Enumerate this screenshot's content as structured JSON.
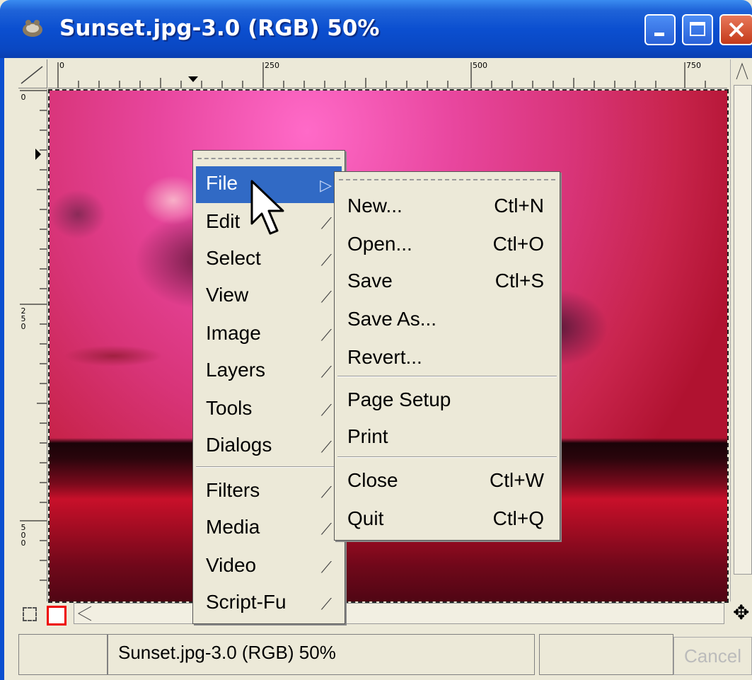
{
  "window": {
    "title": "Sunset.jpg-3.0 (RGB) 50%",
    "buttons": [
      "minimize",
      "maximize",
      "close"
    ]
  },
  "rulers": {
    "horizontal_labels": [
      "0",
      "250",
      "500",
      "750"
    ],
    "vertical_labels": [
      "0",
      "250",
      "500"
    ]
  },
  "status": {
    "text": "Sunset.jpg-3.0 (RGB) 50%",
    "cancel_label": "Cancel"
  },
  "main_menu": {
    "items": [
      {
        "label": "File",
        "selected": true
      },
      {
        "label": "Edit"
      },
      {
        "label": "Select"
      },
      {
        "label": "View"
      },
      {
        "label": "Image"
      },
      {
        "label": "Layers"
      },
      {
        "label": "Tools"
      },
      {
        "label": "Dialogs"
      },
      {
        "label": "Filters"
      },
      {
        "label": "Media"
      },
      {
        "label": "Video"
      },
      {
        "label": "Script-Fu"
      }
    ]
  },
  "file_menu": {
    "items": [
      {
        "label": "New...",
        "shortcut": "Ctl+N"
      },
      {
        "label": "Open...",
        "shortcut": "Ctl+O"
      },
      {
        "label": "Save",
        "shortcut": "Ctl+S"
      },
      {
        "label": "Save As...",
        "shortcut": ""
      },
      {
        "label": "Revert...",
        "shortcut": ""
      },
      {
        "label": "Page Setup",
        "shortcut": ""
      },
      {
        "label": "Print",
        "shortcut": ""
      },
      {
        "label": "Close",
        "shortcut": "Ctl+W"
      },
      {
        "label": "Quit",
        "shortcut": "Ctl+Q"
      }
    ]
  },
  "colors": {
    "titlebar": "#0b4fd0",
    "selection": "#316ac5",
    "menu_bg": "#ece9d8"
  }
}
